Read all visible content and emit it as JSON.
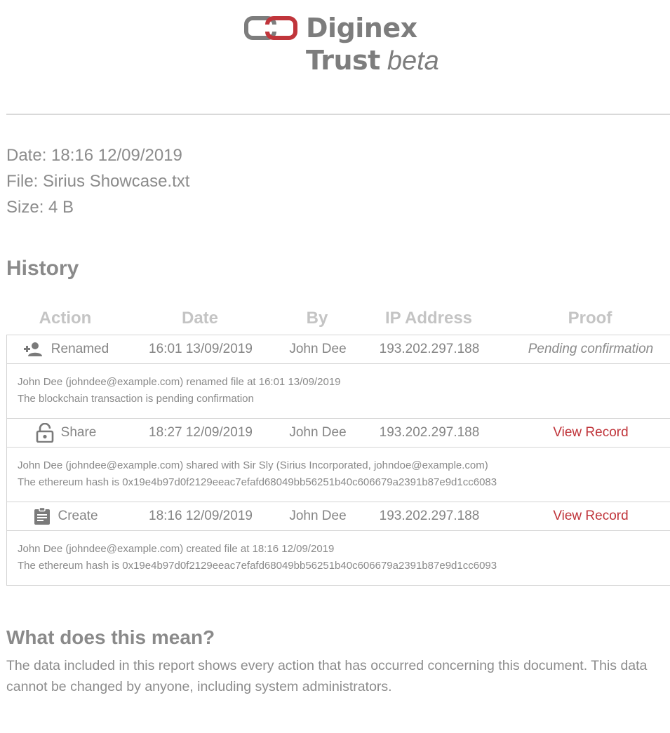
{
  "brand": {
    "name_line1": "Diginex",
    "name_line2": "Trust",
    "tag": "beta",
    "logo_color": "#7d7d7d",
    "logo_accent": "#c0353b"
  },
  "meta": {
    "date": "Date: 18:16 12/09/2019",
    "file": "File: Sirius Showcase.txt",
    "size": "Size: 4 B"
  },
  "history": {
    "heading": "History",
    "columns": [
      "Action",
      "Date",
      "By",
      "IP Address",
      "Proof"
    ],
    "rows": [
      {
        "icon": "person-add-icon",
        "action": "Renamed",
        "date": "16:01 13/09/2019",
        "by": "John Dee",
        "ip": "193.202.297.188",
        "proof": "Pending confirmation",
        "detail_line1": "John Dee (johndee@example.com) renamed file at 16:01 13/09/2019",
        "detail_line2": "The blockchain transaction is pending confirmation"
      },
      {
        "icon": "lock-open-icon",
        "action": "Share",
        "date": "18:27 12/09/2019",
        "by": "John Dee",
        "ip": "193.202.297.188",
        "proof": "View Record",
        "detail_line1": "John Dee (johndee@example.com) shared with Sir Sly (Sirius Incorporated, johndoe@example.com)",
        "detail_line2": "The ethereum hash is 0x19e4b97d0f2129eeac7efafd68049bb56251b40c606679a2391b87e9d1cc6083"
      },
      {
        "icon": "clipboard-icon",
        "action": "Create",
        "date": "18:16 12/09/2019",
        "by": "John Dee",
        "ip": "193.202.297.188",
        "proof": "View Record",
        "detail_line1": "John Dee (johndee@example.com) created file at 18:16 12/09/2019",
        "detail_line2": "The ethereum hash is 0x19e4b97d0f2129eeac7efafd68049bb56251b40c606679a2391b87e9d1cc6093"
      }
    ]
  },
  "explanation": {
    "heading": "What does this mean?",
    "text": "The data included in this report shows every action that has occurred concerning this document. This data cannot be changed by anyone, including system administrators."
  },
  "colors": {
    "text": "#888888",
    "header": "#c4c4c4",
    "link": "#c0353b",
    "border": "#d4d4d4"
  }
}
